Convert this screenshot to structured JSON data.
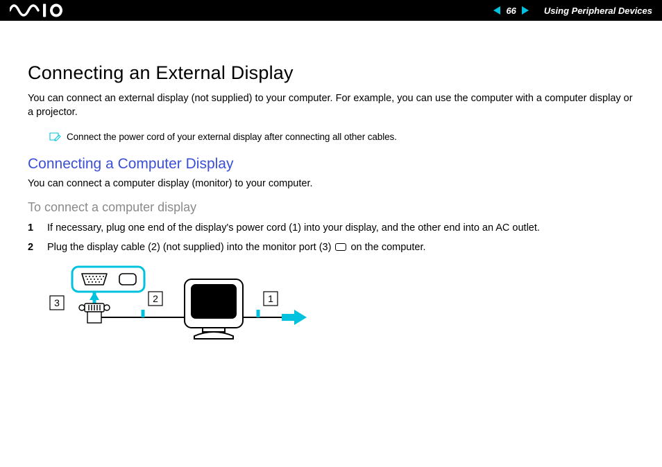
{
  "header": {
    "page_number": "66",
    "section": "Using Peripheral Devices"
  },
  "title": "Connecting an External Display",
  "intro": "You can connect an external display (not supplied) to your computer. For example, you can use the computer with a computer display or a projector.",
  "note": "Connect the power cord of your external display after connecting all other cables.",
  "subsection": {
    "title": "Connecting a Computer Display",
    "body": "You can connect a computer display (monitor) to your computer.",
    "procedure_title": "To connect a computer display",
    "steps": [
      "If necessary, plug one end of the display's power cord (1) into your display, and the other end into an AC outlet.",
      "Plug the display cable (2) (not supplied) into the monitor port (3) ⎚ on the computer."
    ]
  },
  "diagram": {
    "labels": {
      "one": "1",
      "two": "2",
      "three": "3"
    }
  }
}
